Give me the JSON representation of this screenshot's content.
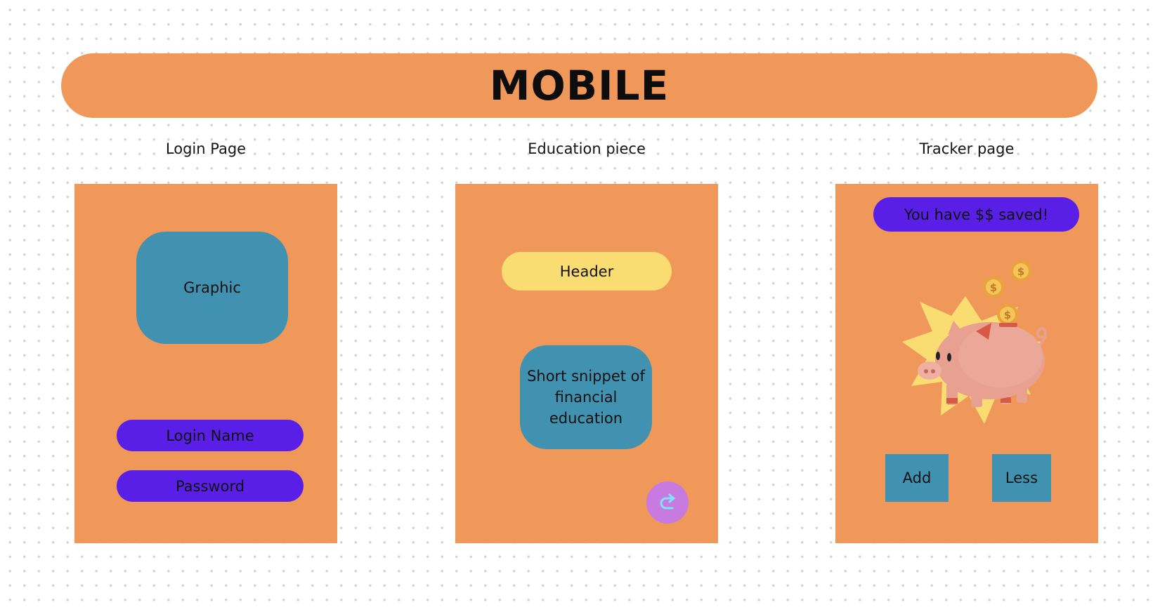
{
  "banner": {
    "title": "MOBILE"
  },
  "screens": {
    "login": {
      "label": "Login Page",
      "graphic_placeholder": "Graphic",
      "login_name_field": "Login Name",
      "password_field": "Password"
    },
    "education": {
      "label": "Education piece",
      "header": "Header",
      "snippet": "Short snippet of financial education",
      "next_icon": "redo-arrow-icon"
    },
    "tracker": {
      "label": "Tracker page",
      "savings_message": "You have $$ saved!",
      "illustration_icon": "piggy-bank-icon",
      "add_button": "Add",
      "less_button": "Less"
    }
  },
  "colors": {
    "card_orange": "#f0985a",
    "purple": "#5a1fe6",
    "teal": "#4192b0",
    "yellow": "#fadd72",
    "next_button": "#c77ae0"
  }
}
